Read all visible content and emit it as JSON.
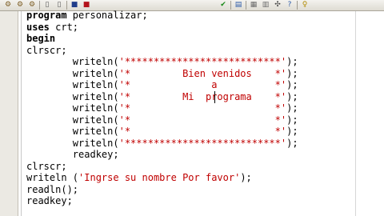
{
  "toolbar": {
    "left_buttons": [
      {
        "icon": "settings-icon",
        "glyph": "⚙",
        "color": "#7a5a20"
      },
      {
        "icon": "run-icon",
        "glyph": "⚙",
        "color": "#7a5a20"
      },
      {
        "icon": "compile-icon",
        "glyph": "⚙",
        "color": "#7a5a20"
      },
      {
        "icon": "new-file-icon",
        "glyph": "▯",
        "color": "#555555"
      },
      {
        "icon": "new-project-icon",
        "glyph": "▯",
        "color": "#555555"
      },
      {
        "icon": "save-icon",
        "glyph": "■",
        "color": "#1f3c8a"
      },
      {
        "icon": "stop-icon",
        "glyph": "■",
        "color": "#b3121a"
      }
    ],
    "right_buttons": [
      {
        "icon": "check-icon",
        "glyph": "✔",
        "color": "#1a8a1a"
      },
      {
        "icon": "step-icon",
        "glyph": "▤",
        "color": "#2b5aa8"
      },
      {
        "icon": "grid-icon",
        "glyph": "▦",
        "color": "#6a6a6a"
      },
      {
        "icon": "options-icon",
        "glyph": "▥",
        "color": "#6a6a6a"
      },
      {
        "icon": "tools-icon",
        "glyph": "✣",
        "color": "#444444"
      },
      {
        "icon": "help-icon",
        "glyph": "?",
        "color": "#2b5aa8"
      },
      {
        "icon": "hint-icon",
        "glyph": "♀",
        "color": "#b08a00"
      }
    ]
  },
  "editor": {
    "lines": [
      {
        "indent": "",
        "keyword": "program",
        "text": " personalizar;",
        "string": "",
        "tail": ""
      },
      {
        "indent": "",
        "keyword": "uses",
        "text": " crt;",
        "string": "",
        "tail": ""
      },
      {
        "indent": "",
        "keyword": "begin",
        "text": "",
        "string": "",
        "tail": ""
      },
      {
        "indent": "",
        "keyword": "",
        "text": "clrscr;",
        "string": "",
        "tail": ""
      },
      {
        "indent": "        ",
        "keyword": "",
        "text": "writeln(",
        "string": "'***************************'",
        "tail": ");"
      },
      {
        "indent": "        ",
        "keyword": "",
        "text": "writeln(",
        "string": "'*         Bien venidos    *'",
        "tail": ");"
      },
      {
        "indent": "        ",
        "keyword": "",
        "text": "writeln(",
        "string": "'*              a          *'",
        "tail": ");"
      },
      {
        "indent": "        ",
        "keyword": "",
        "text": "writeln(",
        "string": "'*         Mi  programa    *'",
        "tail": ");"
      },
      {
        "indent": "        ",
        "keyword": "",
        "text": "writeln(",
        "string": "'*                         *'",
        "tail": ");"
      },
      {
        "indent": "        ",
        "keyword": "",
        "text": "writeln(",
        "string": "'*                         *'",
        "tail": ");"
      },
      {
        "indent": "        ",
        "keyword": "",
        "text": "writeln(",
        "string": "'*                         *'",
        "tail": ");"
      },
      {
        "indent": "        ",
        "keyword": "",
        "text": "writeln(",
        "string": "'***************************'",
        "tail": ");"
      },
      {
        "indent": "        ",
        "keyword": "",
        "text": "readkey;",
        "string": "",
        "tail": ""
      },
      {
        "indent": "",
        "keyword": "",
        "text": "clrscr;",
        "string": "",
        "tail": ""
      },
      {
        "indent": "",
        "keyword": "",
        "text": "writeln (",
        "string": "'Ingrse su nombre Por favor'",
        "tail": ");"
      },
      {
        "indent": "",
        "keyword": "",
        "text": "readln();",
        "string": "",
        "tail": ""
      },
      {
        "indent": "",
        "keyword": "",
        "text": "readkey;",
        "string": "",
        "tail": ""
      }
    ]
  }
}
